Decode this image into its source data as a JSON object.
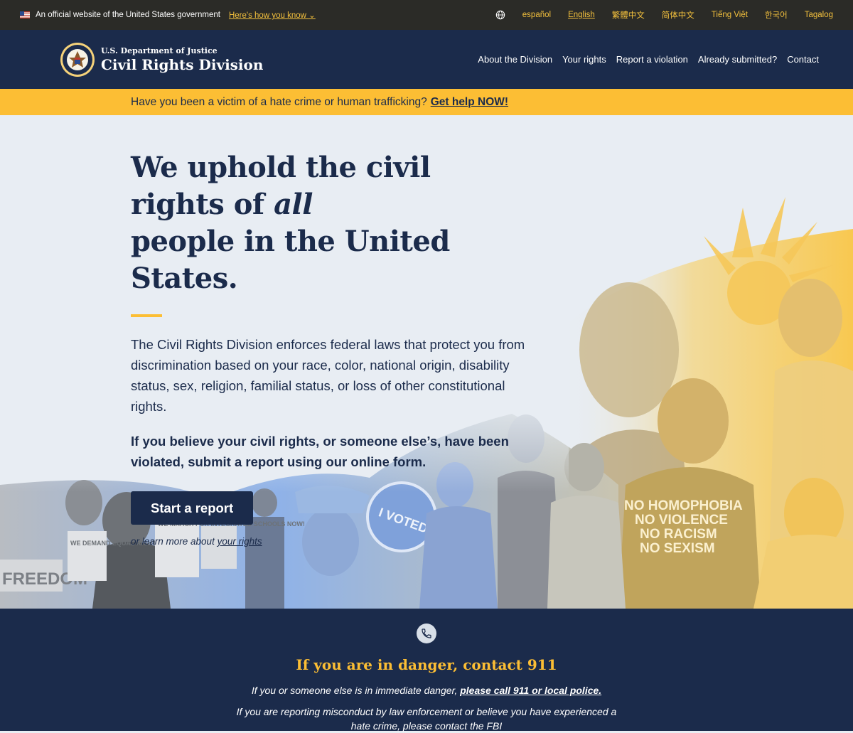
{
  "gov_banner": {
    "text": "An official website of the United States government",
    "link": "Here's how you know",
    "languages": [
      "español",
      "English",
      "繁體中文",
      "简体中文",
      "Tiếng Việt",
      "한국어",
      "Tagalog"
    ]
  },
  "header": {
    "subtitle": "U.S. Department of Justice",
    "title": "Civil Rights Division",
    "nav": [
      "About the Division",
      "Your rights",
      "Report a violation",
      "Already submitted?",
      "Contact"
    ]
  },
  "alert": {
    "text": "Have you been a victim of a hate crime or human trafficking?",
    "link": "Get help NOW!"
  },
  "hero": {
    "title_line1": "We uphold the civil rights of",
    "title_emph": "all",
    "title_line2": "people in the United States.",
    "description": "The Civil Rights Division enforces federal laws that protect you from discrimination based on your race, color, national origin, disability status, sex, religion, familial status, or loss of other constitutional rights.",
    "bold_text": "If you believe your civil rights, or someone else’s, have been violated, submit a report using our online form.",
    "cta_label": "Start a report",
    "learn_prefix": "or learn more about",
    "learn_link": "your rights",
    "signs": [
      "FREEDOM",
      "WE DEMAND EQUAL RIGHTS NOW!",
      "WE MARCH FOR INTEGRATED SCHOOLS NOW!",
      "I VOTED",
      "NO HOMOPHOBIA",
      "NO VIOLENCE",
      "NO RACISM",
      "NO SEXISM"
    ]
  },
  "danger": {
    "title": "If you are in danger, contact 911",
    "line1_prefix": "If you or someone else is in immediate danger,",
    "line1_link": "please call 911 or local police.",
    "line2": "If you are reporting misconduct by law enforcement or believe you have experienced a hate crime, please contact the FBI"
  },
  "colors": {
    "navy": "#1b2b4b",
    "gold": "#fcbe34",
    "bg": "#e8edf3"
  }
}
